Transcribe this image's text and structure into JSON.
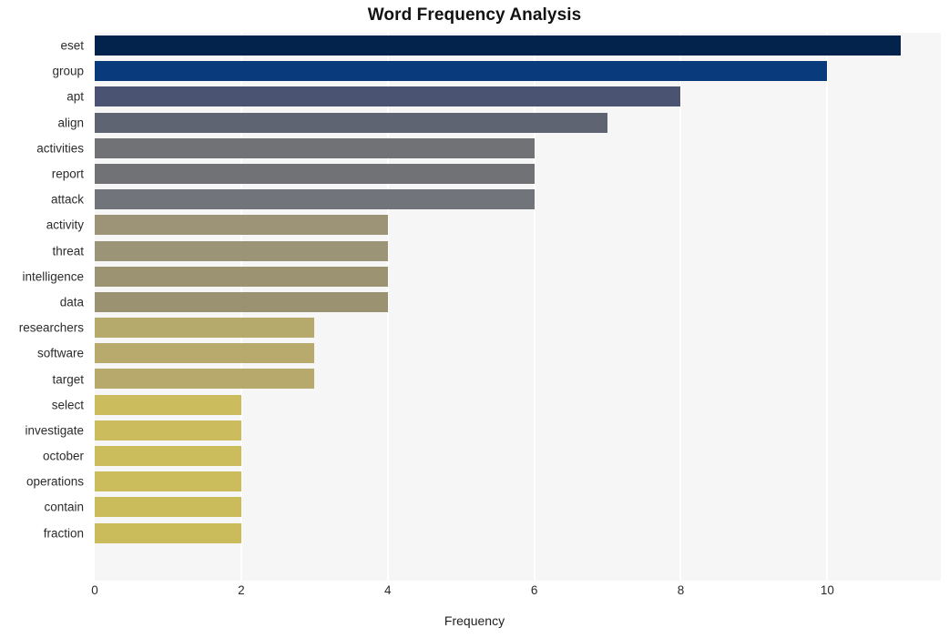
{
  "chart_data": {
    "type": "bar",
    "orientation": "horizontal",
    "title": "Word Frequency Analysis",
    "xlabel": "Frequency",
    "ylabel": "",
    "categories": [
      "eset",
      "group",
      "apt",
      "align",
      "activities",
      "report",
      "attack",
      "activity",
      "threat",
      "intelligence",
      "data",
      "researchers",
      "software",
      "target",
      "select",
      "investigate",
      "october",
      "operations",
      "contain",
      "fraction"
    ],
    "values": [
      11,
      10,
      8,
      7,
      6,
      6,
      6,
      4,
      4,
      4,
      4,
      3,
      3,
      3,
      2,
      2,
      2,
      2,
      2,
      2
    ],
    "bar_colors": [
      "#03224c",
      "#083a7c",
      "#4b5372",
      "#5f6473",
      "#717275",
      "#717276",
      "#72747c",
      "#9d9478",
      "#9c9476",
      "#9c9373",
      "#9b9271",
      "#b6a96c",
      "#b7aa6c",
      "#b6a96b",
      "#cbbc5d",
      "#cbbc5d",
      "#cbbc5c",
      "#cbbc5c",
      "#cbbc5b",
      "#cbbc5b"
    ],
    "xlim": [
      0,
      11.55
    ],
    "x_ticks": [
      0,
      2,
      4,
      6,
      8,
      10
    ],
    "x_tick_labels": [
      "0",
      "2",
      "4",
      "6",
      "8",
      "10"
    ],
    "gridlines": {
      "vertical": true,
      "horizontal": false,
      "color": "#ffffff"
    },
    "plot_background": "#f6f6f7",
    "figure_background": "#ffffff",
    "legend": {
      "visible": false,
      "position": "none"
    }
  }
}
